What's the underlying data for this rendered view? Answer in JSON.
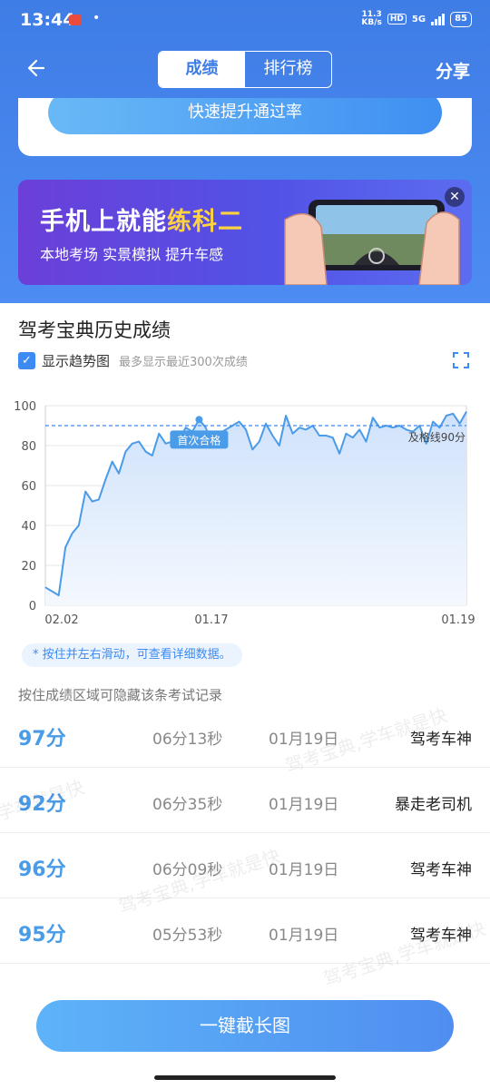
{
  "status": {
    "time": "13:44",
    "dot": "•",
    "net_speed": "11.3",
    "net_unit": "KB/s",
    "hd": "HD",
    "network": "5G",
    "battery": "85"
  },
  "nav": {
    "tabs": [
      "成绩",
      "排行榜"
    ],
    "active_tab": "成绩",
    "share": "分享"
  },
  "result_card": {
    "button": "快速提升通过率"
  },
  "banner": {
    "title_prefix": "手机上就能",
    "title_highlight": "练科二",
    "subtitle": "本地考场 实景模拟 提升车感"
  },
  "history": {
    "title": "驾考宝典历史成绩",
    "trend_label": "显示趋势图",
    "trend_note": "最多显示最近300次成绩"
  },
  "chart_data": {
    "type": "area",
    "y_ticks": [
      0,
      20,
      40,
      60,
      80,
      100
    ],
    "x_tick_labels": [
      "02.02",
      "01.17",
      "01.19"
    ],
    "ylim": [
      0,
      100
    ],
    "pass_line": 90,
    "pass_label": "及格线90分",
    "first_pass_label": "首次合格",
    "first_pass_index": 23,
    "values": [
      9,
      7,
      5,
      29,
      36,
      40,
      57,
      52,
      53,
      63,
      72,
      66,
      77,
      81,
      82,
      77,
      75,
      86,
      81,
      82,
      83,
      89,
      87,
      93,
      89,
      79,
      86,
      88,
      90,
      92,
      88,
      78,
      82,
      91,
      85,
      80,
      95,
      86,
      89,
      88,
      90,
      85,
      85,
      84,
      76,
      86,
      84,
      88,
      82,
      94,
      89,
      90,
      89,
      90,
      88,
      87,
      90,
      81,
      92,
      89,
      95,
      96,
      91,
      97
    ]
  },
  "hint": "* 按住并左右滑动，可查看详细数据。",
  "hide_tip": "按住成绩区域可隐藏该条考试记录",
  "records": [
    {
      "score": "97分",
      "duration": "06分13秒",
      "date": "01月19日",
      "title": "驾考车神"
    },
    {
      "score": "92分",
      "duration": "06分35秒",
      "date": "01月19日",
      "title": "暴走老司机"
    },
    {
      "score": "96分",
      "duration": "06分09秒",
      "date": "01月19日",
      "title": "驾考车神"
    },
    {
      "score": "95分",
      "duration": "05分53秒",
      "date": "01月19日",
      "title": "驾考车神"
    }
  ],
  "watermarks": [
    "驾考宝典,学车就是快",
    "学车就是快",
    "驾考宝典,学车就是快",
    "驾考宝典,学车就是快"
  ],
  "colors": {
    "primary": "#3f7de6",
    "accent": "#4a9be8",
    "highlight": "#ffd23f",
    "banner": "#6b3fd8"
  },
  "footer": {
    "button": "一键截长图"
  }
}
